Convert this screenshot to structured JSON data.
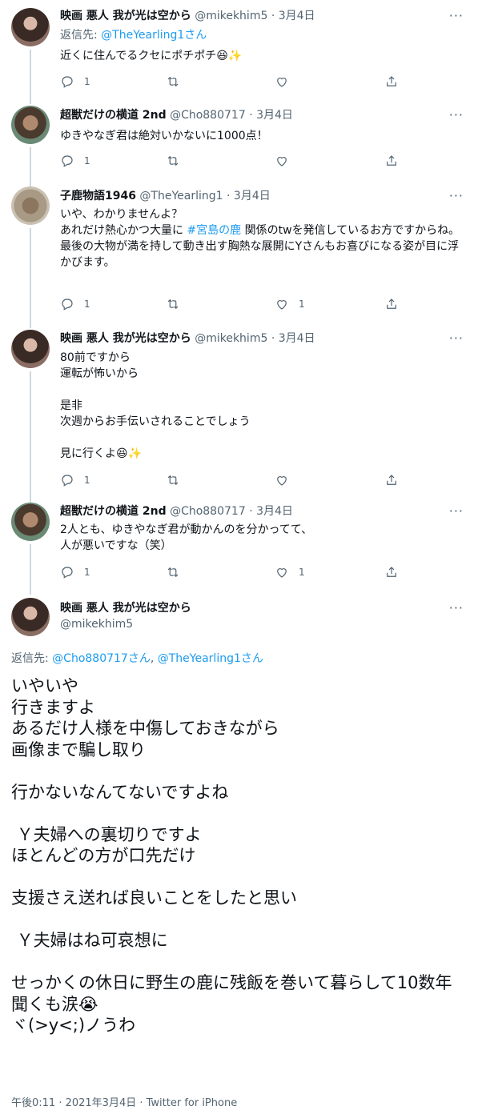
{
  "tweets": [
    {
      "name": "映画 悪人 我が光は空から",
      "handle": "@mikekhim5",
      "dot": "·",
      "time": "3月4日",
      "reply_prefix": "返信先: ",
      "reply_to": "@TheYearling1さん",
      "text": "近くに住んでるクセにポチポチ😆✨",
      "reply_count": "1",
      "retweet_count": "",
      "like_count": ""
    },
    {
      "name": "超獣だけの横道 2nd",
      "handle": "@Cho880717",
      "dot": "·",
      "time": "3月4日",
      "text": "ゆきやなぎ君は絶対いかないに1000点！",
      "reply_count": "1",
      "retweet_count": "",
      "like_count": ""
    },
    {
      "name": "子鹿物語1946",
      "handle": "@TheYearling1",
      "dot": "·",
      "time": "3月4日",
      "text_before_tag": "いや、わかりませんよ？\nあれだけ熱心かつ大量に ",
      "hashtag": "#宮島の鹿",
      "text_after_tag": " 関係のtwを発信しているお方ですからね。\n最後の大物が満を持して動き出す胸熱な展開にYさんもお喜びになる姿が目に浮かびます。",
      "reply_count": "1",
      "retweet_count": "",
      "like_count": "1"
    },
    {
      "name": "映画 悪人 我が光は空から",
      "handle": "@mikekhim5",
      "dot": "·",
      "time": "3月4日",
      "text": "80前ですから\n運転が怖いから\n\n是非\n次週からお手伝いされることでしょう\n\n見に行くよ😆✨",
      "reply_count": "1",
      "retweet_count": "",
      "like_count": ""
    },
    {
      "name": "超獣だけの横道 2nd",
      "handle": "@Cho880717",
      "dot": "·",
      "time": "3月4日",
      "text": "2人とも、ゆきやなぎ君が動かんのを分かってて、\n人が悪いですな（笑）",
      "reply_count": "1",
      "retweet_count": "",
      "like_count": "1"
    }
  ],
  "focus": {
    "name": "映画 悪人 我が光は空から",
    "handle": "@mikekhim5",
    "reply_prefix": "返信先: ",
    "reply_to_1": "@Cho880717さん",
    "reply_sep": ", ",
    "reply_to_2": "@TheYearling1さん",
    "text": "いやいや\n行きますよ\nあるだけ人様を中傷しておきながら\n画像まで騙し取り\n\n行かないなんてないですよね\n\n Ｙ夫婦への裏切りですよ\nほとんどの方が口先だけ\n\n支援さえ送れば良いことをしたと思い\n\n Ｙ夫婦はね可哀想に\n\nせっかくの休日に野生の鹿に残飯を巻いて暮らして10数年\n聞くも涙😭\nヾ(>y<;)ノうわ",
    "meta": "午後0:11 · 2021年3月4日 · Twitter for iPhone"
  },
  "icons": [
    "more-icon",
    "reply-icon",
    "retweet-icon",
    "like-icon",
    "share-icon"
  ]
}
